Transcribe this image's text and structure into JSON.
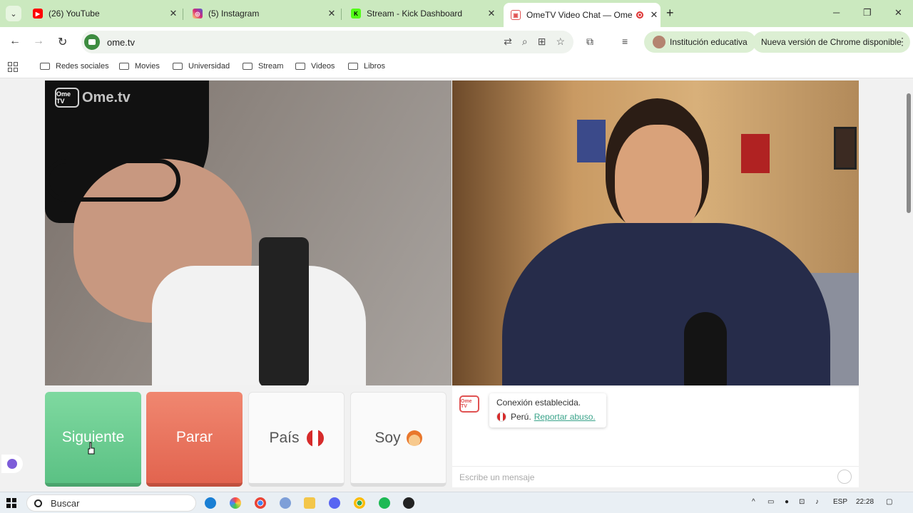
{
  "tabs": [
    {
      "title": "(26) YouTube",
      "favicon": "youtube-icon",
      "color": "#ff0000"
    },
    {
      "title": "(5) Instagram",
      "favicon": "instagram-icon",
      "color": "#d62976"
    },
    {
      "title": "Stream - Kick Dashboard",
      "favicon": "kick-icon",
      "color": "#53fc18"
    },
    {
      "title": "OmeTV Video Chat — Ome",
      "favicon": "ometv-icon",
      "color": "#e05252",
      "active": true
    }
  ],
  "toolbar": {
    "url": "ome.tv",
    "profile_label": "Institución educativa",
    "update_label": "Nueva versión de Chrome disponible"
  },
  "bookmarks": [
    "Redes sociales",
    "Movies",
    "Universidad",
    "Stream",
    "Videos",
    "Libros"
  ],
  "video": {
    "logo_text": "Ome.tv",
    "logo_badge": "Ome TV"
  },
  "buttons": {
    "next": "Siguiente",
    "stop": "Parar",
    "country": "País",
    "soy": "Soy"
  },
  "chat": {
    "logo_badge": "Ome TV",
    "status": "Conexión establecida.",
    "country": "Perú.",
    "report": "Reportar abuso.",
    "placeholder": "Escribe un mensaje"
  },
  "taskbar": {
    "search": "Buscar",
    "language": "ESP",
    "time": "22:28"
  },
  "colors": {
    "accent": "#5bc184",
    "stop": "#e2644f",
    "tabbar": "#cbe9bf"
  }
}
